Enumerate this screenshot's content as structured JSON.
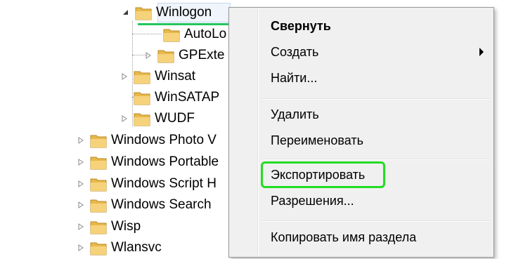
{
  "tree": {
    "selected": "Winlogon",
    "items": [
      {
        "label": "Winlogon",
        "expander": "expanded"
      },
      {
        "label": "AutoLo",
        "expander": "none"
      },
      {
        "label": "GPExte",
        "expander": "collapsed"
      },
      {
        "label": "Winsat",
        "expander": "collapsed"
      },
      {
        "label": "WinSATAP",
        "expander": "none"
      },
      {
        "label": "WUDF",
        "expander": "collapsed"
      },
      {
        "label": "Windows Photo V",
        "expander": "collapsed"
      },
      {
        "label": "Windows Portable",
        "expander": "collapsed"
      },
      {
        "label": "Windows Script H",
        "expander": "collapsed"
      },
      {
        "label": "Windows Search",
        "expander": "collapsed"
      },
      {
        "label": "Wisp",
        "expander": "collapsed"
      },
      {
        "label": "Wlansvc",
        "expander": "collapsed"
      }
    ]
  },
  "context_menu": {
    "items": [
      {
        "label": "Свернуть",
        "bold": true
      },
      {
        "label": "Создать",
        "has_submenu": true
      },
      {
        "label": "Найти..."
      },
      {
        "label": "Удалить"
      },
      {
        "label": "Переименовать"
      },
      {
        "label": "Экспортировать",
        "highlighted": true
      },
      {
        "label": "Разрешения..."
      },
      {
        "label": "Копировать имя раздела"
      }
    ]
  },
  "colors": {
    "highlight": "#22dd22",
    "selection_underline": "#22c55e",
    "folder": "#e8b84a",
    "menu_bg": "#f0f0f0"
  }
}
